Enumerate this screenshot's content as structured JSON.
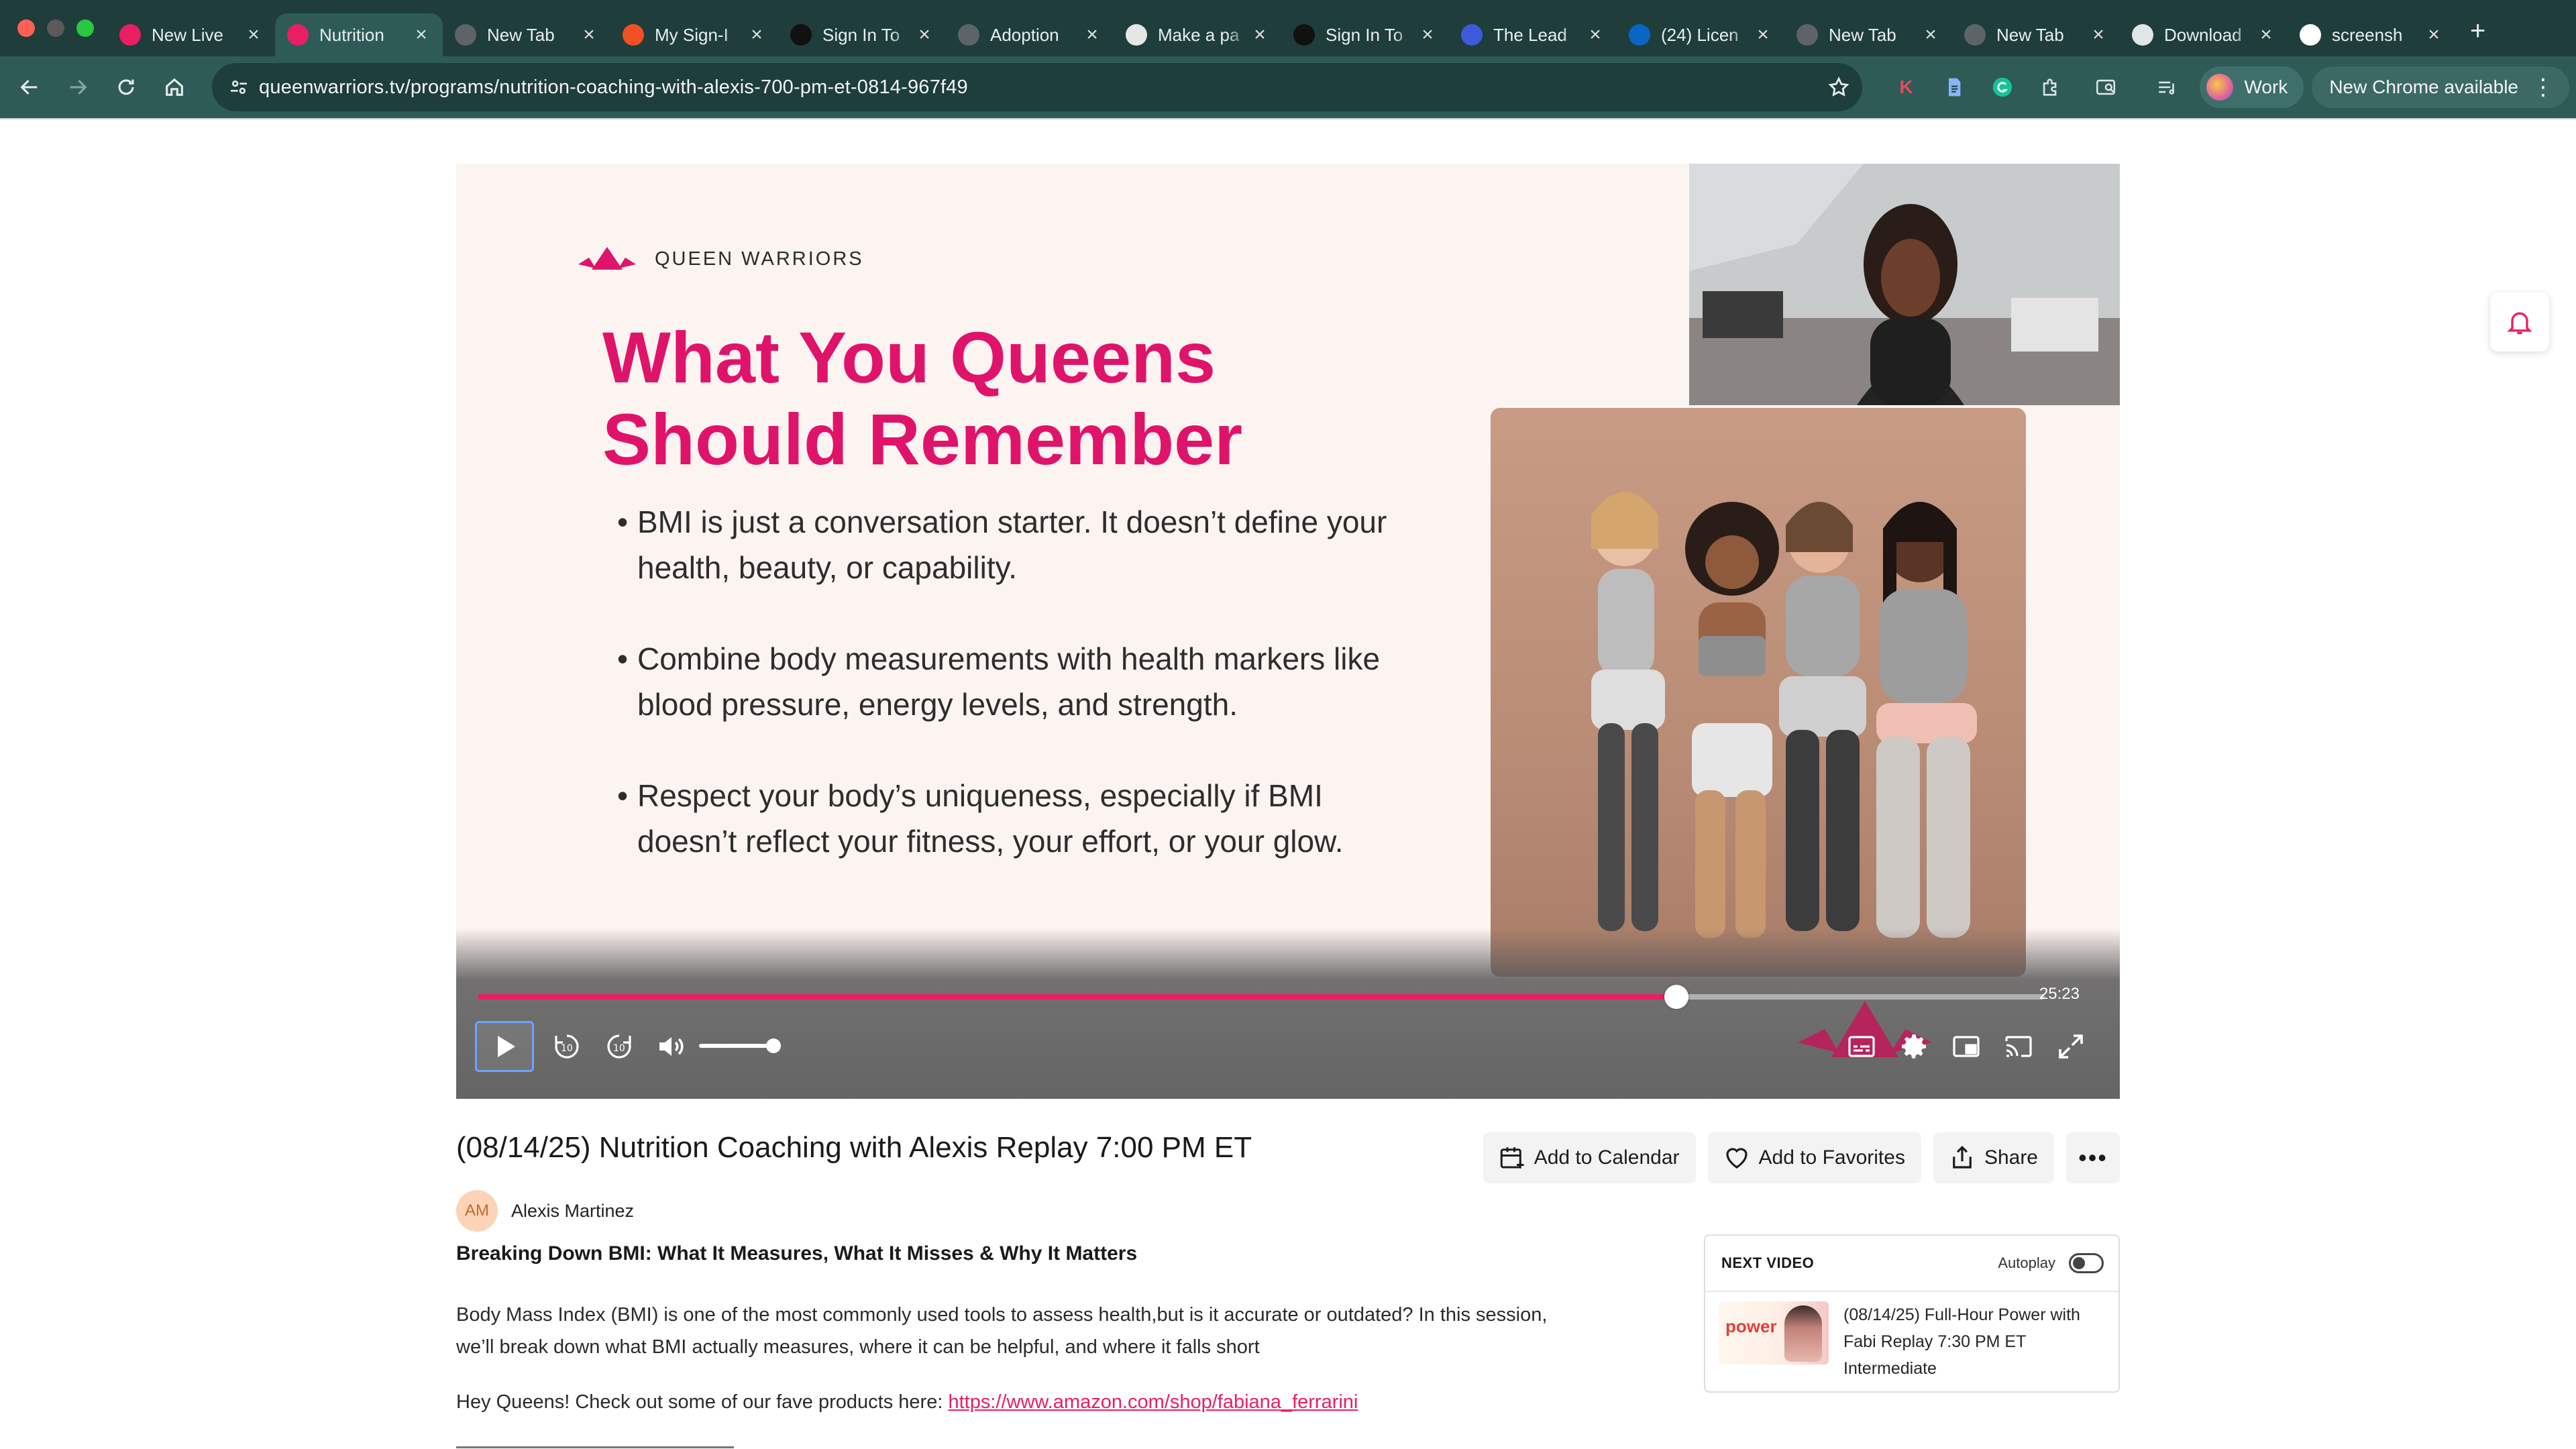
{
  "browser": {
    "tabs": [
      {
        "title": "New Live",
        "favicon": "qw-logo-icon",
        "color": "#e91e63"
      },
      {
        "title": "Nutrition",
        "favicon": "qw-logo-icon",
        "color": "#e91e63",
        "active": true
      },
      {
        "title": "New Tab",
        "favicon": "chrome-icon",
        "color": "#5f6368"
      },
      {
        "title": "My Sign-I",
        "favicon": "microsoft-icon",
        "color": "#f25022"
      },
      {
        "title": "Sign In To",
        "favicon": "dark-app-icon",
        "color": "#111111"
      },
      {
        "title": "Adoption",
        "favicon": "chrome-icon",
        "color": "#5f6368"
      },
      {
        "title": "Make a pa",
        "favicon": "account-icon",
        "color": "#e6e6e6"
      },
      {
        "title": "Sign In To",
        "favicon": "dark-app-icon",
        "color": "#111111"
      },
      {
        "title": "The Lead",
        "favicon": "gear-star-icon",
        "color": "#3b5bdb"
      },
      {
        "title": "(24) Licen",
        "favicon": "linkedin-icon",
        "color": "#0a66c2"
      },
      {
        "title": "New Tab",
        "favicon": "chrome-icon",
        "color": "#5f6368"
      },
      {
        "title": "New Tab",
        "favicon": "chrome-icon",
        "color": "#5f6368"
      },
      {
        "title": "Download",
        "favicon": "download-icon",
        "color": "#dfe6e5"
      },
      {
        "title": "screensh",
        "favicon": "google-icon",
        "color": "#ffffff"
      }
    ],
    "url": "queenwarriors.tv/programs/nutrition-coaching-with-alexis-700-pm-et-0814-967f49",
    "profile_label": "Work",
    "update_label": "New Chrome available",
    "extension_k": "K"
  },
  "player": {
    "slide": {
      "brand": "QUEEN WARRIORS",
      "title_line1": "What You Queens",
      "title_line2": "Should Remember",
      "bullets": [
        "BMI is just a conversation starter. It doesn’t define your health, beauty, or capability.",
        "Combine body measurements with health markers like blood pressure, energy levels, and strength.",
        "Respect your body’s uniqueness, especially if BMI doesn’t reflect your fitness, your effort, or your glow."
      ]
    },
    "progress_fraction": 0.765,
    "duration": "25:23",
    "volume_fraction": 1.0,
    "accent": "#e91e63"
  },
  "video": {
    "title": "(08/14/25) Nutrition Coaching with Alexis Replay 7:00 PM ET",
    "actions": {
      "calendar": "Add to Calendar",
      "favorites": "Add to Favorites",
      "share": "Share",
      "more": "•••"
    },
    "author_initials": "AM",
    "author_name": "Alexis Martinez",
    "subtitle": "Breaking Down BMI: What It Measures, What It Misses & Why It Matters",
    "description": "Body Mass Index (BMI) is one of the most commonly used tools to assess health,but is it accurate or outdated? In this session, we’ll break down what BMI actually measures, where it can be helpful, and where it falls short",
    "promo_text": "Hey Queens! Check out some of our fave products here: ",
    "promo_link": "https://www.amazon.com/shop/fabiana_ferrarini"
  },
  "next_video": {
    "header": "NEXT VIDEO",
    "autoplay_label": "Autoplay",
    "autoplay_on": false,
    "thumb_text": "power",
    "title": "(08/14/25) Full-Hour Power with Fabi Replay 7:30 PM ET Intermediate"
  }
}
